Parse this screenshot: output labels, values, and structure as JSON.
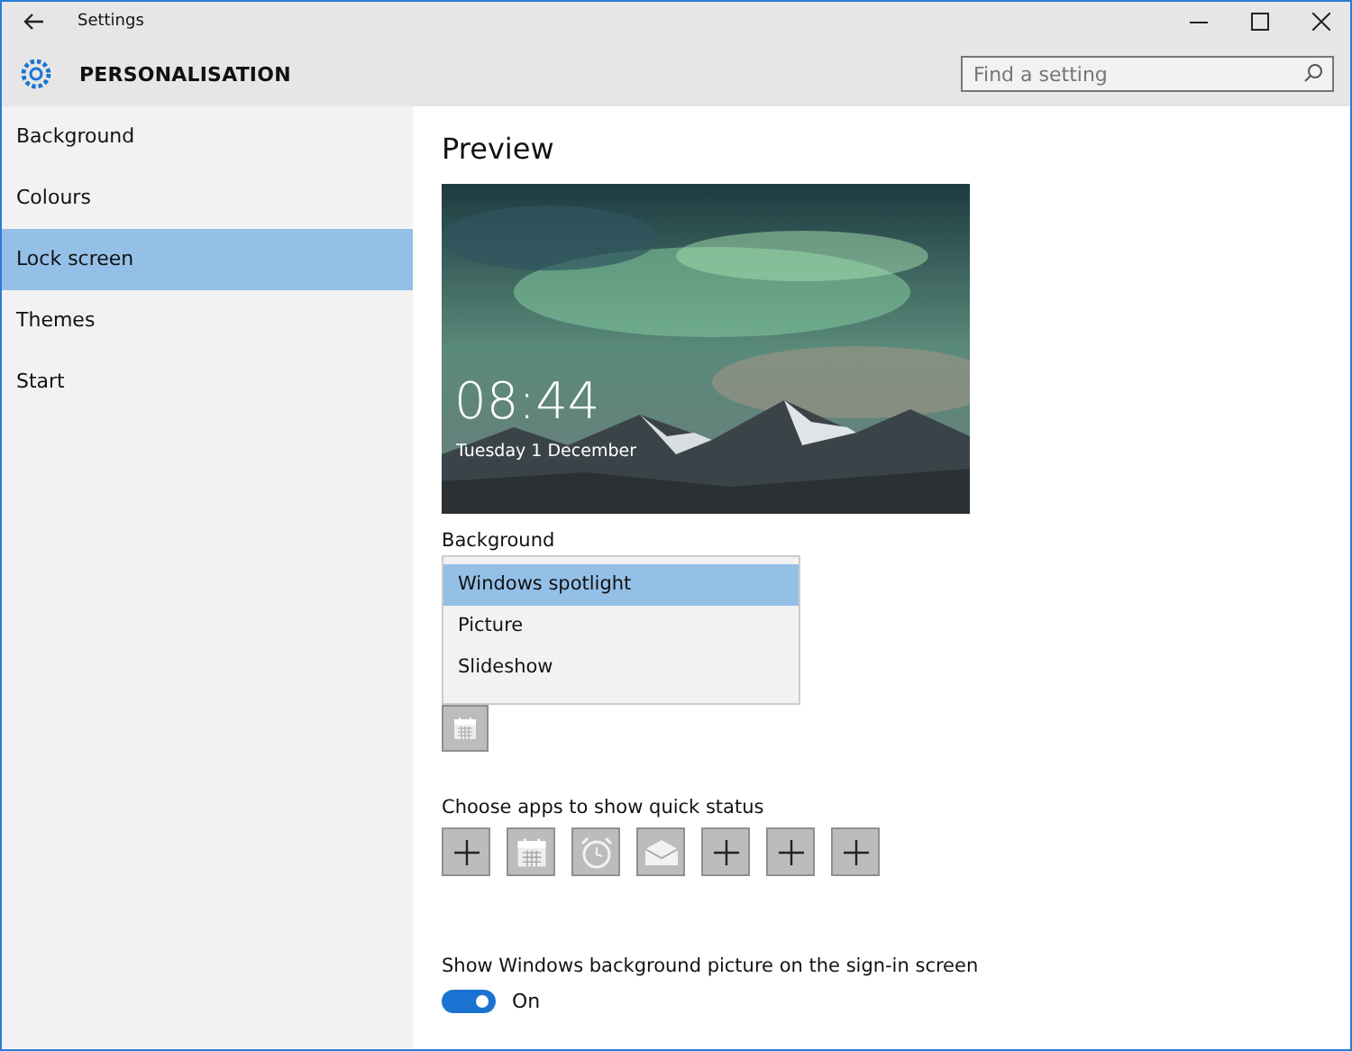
{
  "window": {
    "title": "Settings"
  },
  "header": {
    "title": "PERSONALISATION",
    "search": {
      "placeholder": "Find a setting"
    }
  },
  "sidebar": {
    "items": [
      {
        "label": "Background",
        "selected": false
      },
      {
        "label": "Colours",
        "selected": false
      },
      {
        "label": "Lock screen",
        "selected": true
      },
      {
        "label": "Themes",
        "selected": false
      },
      {
        "label": "Start",
        "selected": false
      }
    ]
  },
  "content": {
    "heading": "Preview",
    "preview": {
      "time": "08:44",
      "date": "Tuesday 1 December"
    },
    "background": {
      "label": "Background",
      "options": [
        {
          "label": "Windows spotlight",
          "selected": true
        },
        {
          "label": "Picture",
          "selected": false
        },
        {
          "label": "Slideshow",
          "selected": false
        }
      ]
    },
    "quick_status": {
      "label": "Choose apps to show quick status",
      "apps": [
        {
          "kind": "add"
        },
        {
          "kind": "calendar"
        },
        {
          "kind": "alarm"
        },
        {
          "kind": "mail"
        },
        {
          "kind": "add"
        },
        {
          "kind": "add"
        },
        {
          "kind": "add"
        }
      ]
    },
    "signin": {
      "label": "Show Windows background picture on the sign-in screen",
      "on": true,
      "state_label": "On"
    }
  }
}
